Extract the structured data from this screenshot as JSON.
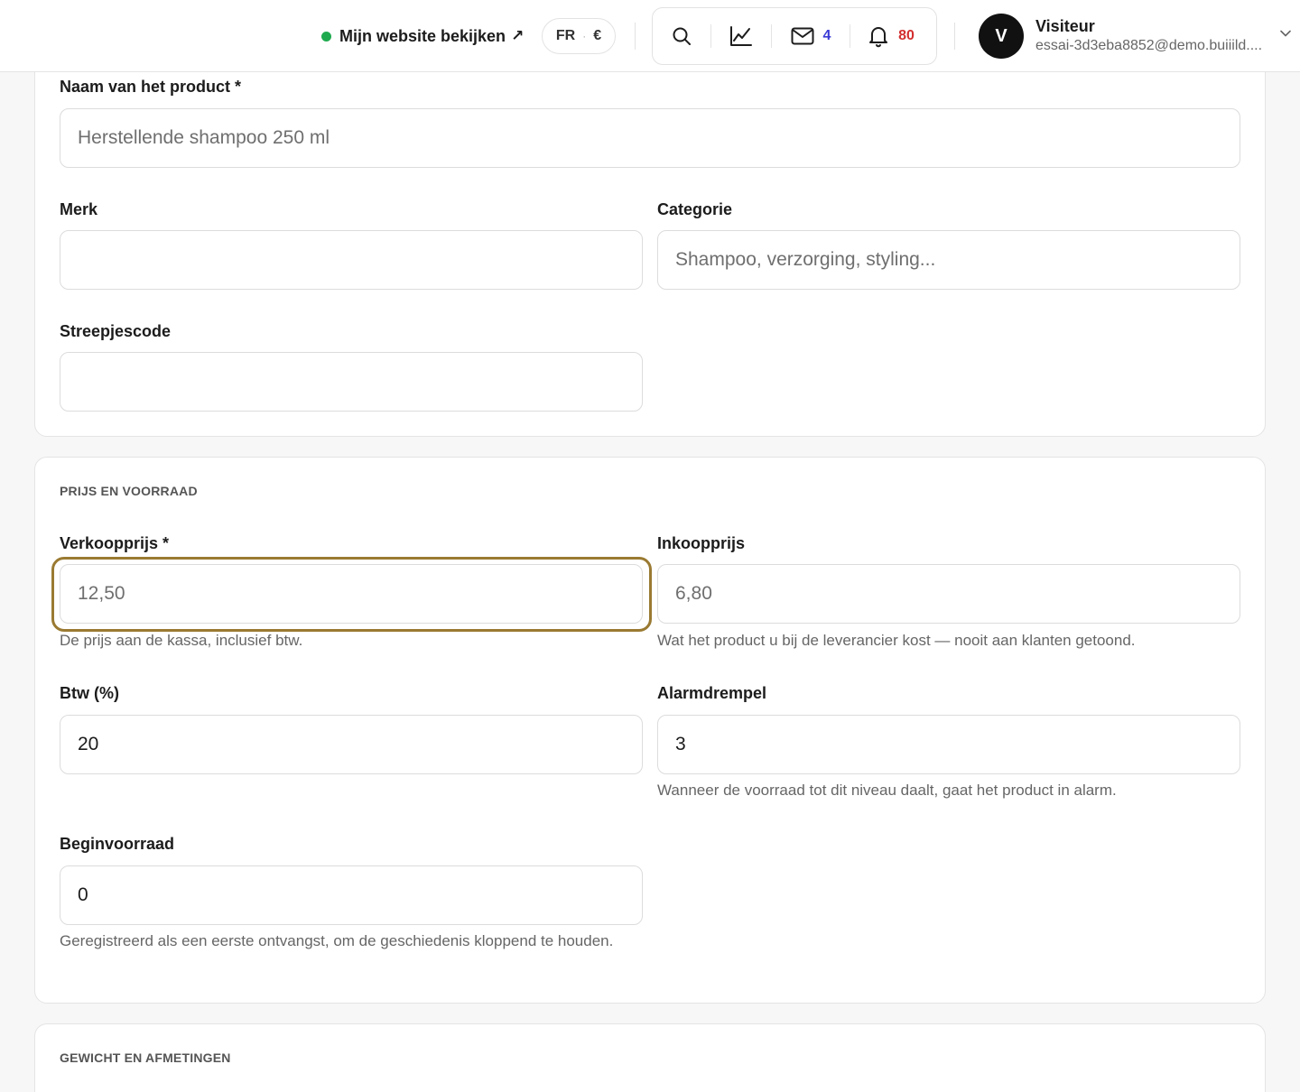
{
  "topbar": {
    "view_site_label": "Mijn website bekijken",
    "view_site_arrow": "↗",
    "language": "FR",
    "currency": "€",
    "messages_count": "4",
    "notifications_count": "80",
    "user": {
      "initial": "V",
      "name": "Visiteur",
      "email": "essai-3d3eba8852@demo.buiiild...."
    }
  },
  "product_section": {
    "name_label": "Naam van het product *",
    "name_placeholder": "Herstellende shampoo 250 ml",
    "brand_label": "Merk",
    "brand_value": "",
    "category_label": "Categorie",
    "category_placeholder": "Shampoo, verzorging, styling...",
    "barcode_label": "Streepjescode",
    "barcode_value": ""
  },
  "price_section": {
    "title": "PRIJS EN VOORRAAD",
    "sale_price_label": "Verkoopprijs *",
    "sale_price_placeholder": "12,50",
    "sale_price_hint": "De prijs aan de kassa, inclusief btw.",
    "purchase_price_label": "Inkoopprijs",
    "purchase_price_placeholder": "6,80",
    "purchase_price_hint": "Wat het product u bij de leverancier kost — nooit aan klanten getoond.",
    "vat_label": "Btw (%)",
    "vat_value": "20",
    "alarm_label": "Alarmdrempel",
    "alarm_value": "3",
    "alarm_hint": "Wanneer de voorraad tot dit niveau daalt, gaat het product in alarm.",
    "initial_stock_label": "Beginvoorraad",
    "initial_stock_value": "0",
    "initial_stock_hint": "Geregistreerd als een eerste ontvangst, om de geschiedenis kloppend te houden."
  },
  "weight_section": {
    "title": "GEWICHT EN AFMETINGEN"
  }
}
